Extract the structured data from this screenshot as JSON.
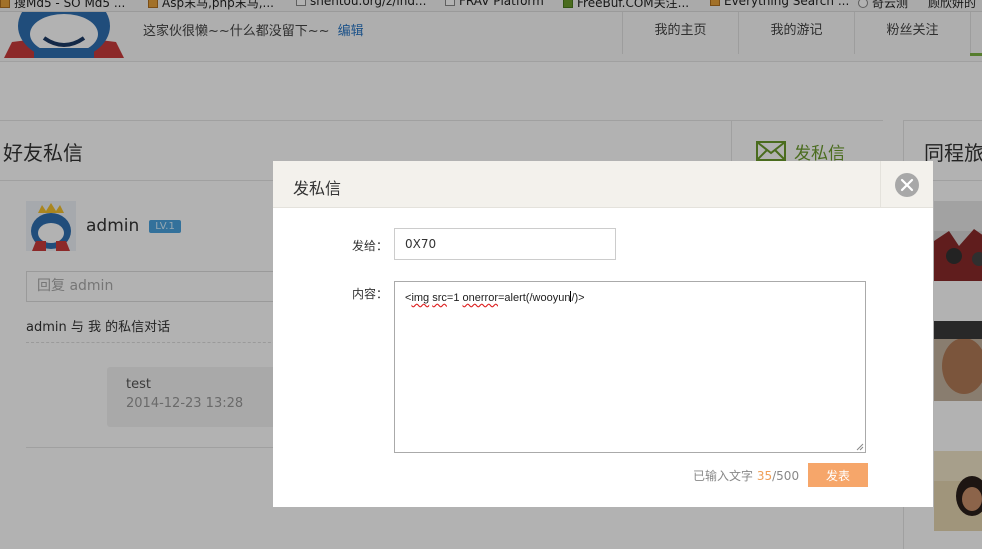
{
  "bookmarks": [
    {
      "label": "搜Md5 - SO Md5 ...",
      "icon": "orange"
    },
    {
      "label": "Asp末马,php末马,...",
      "icon": "orange"
    },
    {
      "label": "shentou.org/z/ind...",
      "icon": "page"
    },
    {
      "label": "FRAV Platform",
      "icon": "page"
    },
    {
      "label": "FreeBuf.COM关注...",
      "icon": "green"
    },
    {
      "label": "Everything Search ...",
      "icon": "orange"
    },
    {
      "label": "奇云测",
      "icon": "circle"
    },
    {
      "label": "顾欣妍的",
      "icon": "none"
    }
  ],
  "header": {
    "bio": "这家伙很懒~~什么都没留下~~",
    "edit_label": "编辑",
    "nav": [
      "我的主页",
      "我的游记",
      "粉丝关注"
    ]
  },
  "main": {
    "title": "好友私信",
    "send_tab_label": "发私信",
    "username": "admin",
    "level": "LV.1",
    "reply_placeholder": "回复 admin",
    "conversation_title": "admin 与 我 的私信对话",
    "message": {
      "text": "test",
      "time": "2014-12-23 13:28"
    }
  },
  "right_panel": {
    "title": "同程旅"
  },
  "dialog": {
    "title": "发私信",
    "to_label": "发给：",
    "to_value": "0X70",
    "content_label": "内容：",
    "content_parts": [
      "<",
      "img",
      " ",
      "src",
      "=1 ",
      "onerror",
      "=alert(/wooyun",
      "/)>"
    ],
    "count_prefix": "已输入文字",
    "count_current": "35",
    "count_suffix": "/500",
    "send_label": "发表"
  },
  "colors": {
    "accent_green": "#6a9b2c",
    "send_button": "#f6a66a",
    "count_highlight": "#f0a057",
    "link_blue": "#2b77c4",
    "badge_blue": "#4aa3df"
  }
}
